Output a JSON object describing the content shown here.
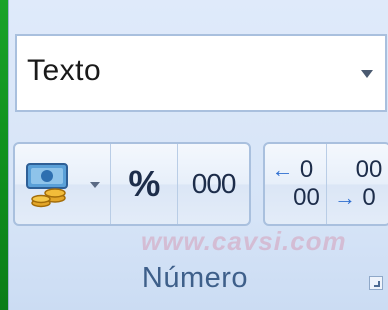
{
  "number_group": {
    "format_value": "Texto",
    "percent_label": "%",
    "thousands_label": "000",
    "increase_decimal": {
      "top": "0",
      "bottom": "00"
    },
    "decrease_decimal": {
      "top": "00",
      "bottom": "0"
    },
    "group_label": "Número",
    "watermark": "www.cavsi.com"
  },
  "icons": {
    "currency": "currency-icon",
    "dropdown": "chevron-down-icon",
    "dialog_launcher": "dialog-launcher-icon"
  },
  "colors": {
    "ribbon_background": "#dfeafa",
    "label_text": "#3e5f8a",
    "outer_background": "#1aa32a"
  }
}
